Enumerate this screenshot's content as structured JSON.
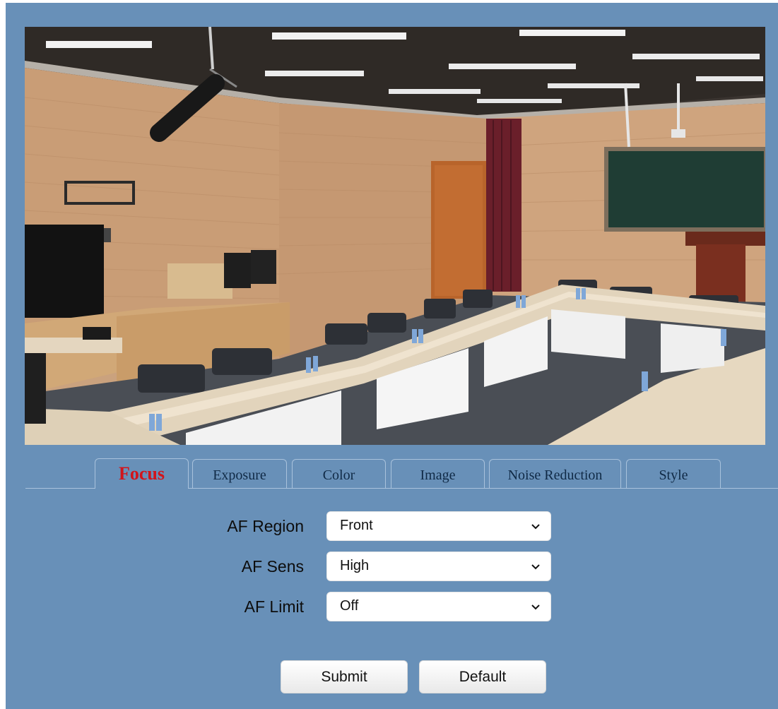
{
  "preview": {
    "icon": "camera-live-view"
  },
  "tabs": [
    {
      "label": "Focus",
      "active": true
    },
    {
      "label": "Exposure",
      "active": false
    },
    {
      "label": "Color",
      "active": false
    },
    {
      "label": "Image",
      "active": false
    },
    {
      "label": "Noise Reduction",
      "active": false
    },
    {
      "label": "Style",
      "active": false
    }
  ],
  "focus": {
    "fields": [
      {
        "label": "AF Region",
        "value": "Front"
      },
      {
        "label": "AF Sens",
        "value": "High"
      },
      {
        "label": "AF Limit",
        "value": "Off"
      }
    ]
  },
  "buttons": {
    "submit": "Submit",
    "default": "Default"
  },
  "colors": {
    "background": "#6890b8",
    "active_tab": "#d2141b",
    "tab_text": "#102a46"
  }
}
